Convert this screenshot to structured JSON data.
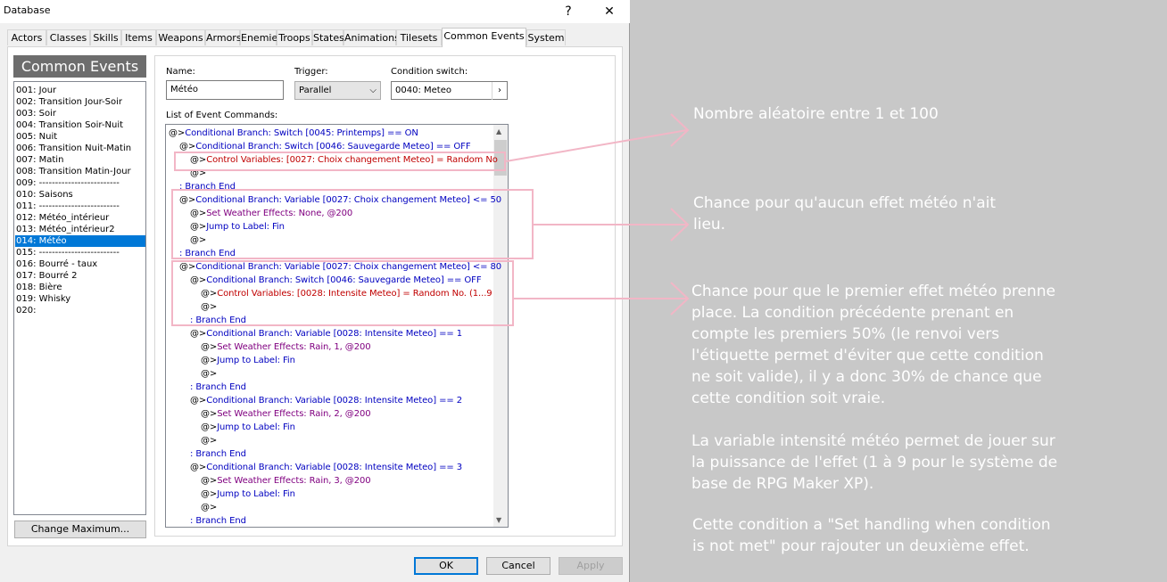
{
  "window": {
    "title": "Database",
    "help_icon": "?",
    "close_icon": "✕"
  },
  "tabs": [
    "Actors",
    "Classes",
    "Skills",
    "Items",
    "Weapons",
    "Armors",
    "Enemies",
    "Troops",
    "States",
    "Animations",
    "Tilesets",
    "Common Events",
    "System"
  ],
  "active_tab": "Common Events",
  "sidebar": {
    "header": "Common Events",
    "items": [
      "001: Jour",
      "002: Transition Jour-Soir",
      "003: Soir",
      "004: Transition Soir-Nuit",
      "005: Nuit",
      "006: Transition Nuit-Matin",
      "007: Matin",
      "008: Transition Matin-Jour",
      "009: -------------------------",
      "010: Saisons",
      "011: -------------------------",
      "012: Météo_intérieur",
      "013: Météo_intérieur2",
      "014: Météo",
      "015: -------------------------",
      "016: Bourré - taux",
      "017: Bourré 2",
      "018: Bière",
      "019: Whisky",
      "020: "
    ],
    "selected_index": 13,
    "change_max_label": "Change Maximum..."
  },
  "form": {
    "name_label": "Name:",
    "name_value": "Météo",
    "trigger_label": "Trigger:",
    "trigger_value": "Parallel",
    "condition_label": "Condition switch:",
    "condition_value": "0040: Meteo",
    "list_label": "List of Event Commands:"
  },
  "commands": [
    {
      "indent": 0,
      "prefix": "@>",
      "text": "Conditional Branch: Switch [0045: Printemps] == ON",
      "color": "#0000c0"
    },
    {
      "indent": 1,
      "prefix": "@>",
      "text": "Conditional Branch: Switch [0046: Sauvegarde Meteo] == OFF",
      "color": "#0000c0"
    },
    {
      "indent": 2,
      "prefix": "@>",
      "text": "Control Variables: [0027: Choix changement Meteo] = Random No",
      "color": "#c00000"
    },
    {
      "indent": 2,
      "prefix": "@>",
      "text": "",
      "color": "#000000"
    },
    {
      "indent": 1,
      "prefix": " : ",
      "text": "Branch End",
      "color": "#0000c0"
    },
    {
      "indent": 1,
      "prefix": "@>",
      "text": "Conditional Branch: Variable [0027: Choix changement Meteo] <= 50",
      "color": "#0000c0"
    },
    {
      "indent": 2,
      "prefix": "@>",
      "text": "Set Weather Effects: None, @200",
      "color": "#800080"
    },
    {
      "indent": 2,
      "prefix": "@>",
      "text": "Jump to Label: Fin",
      "color": "#0000c0"
    },
    {
      "indent": 2,
      "prefix": "@>",
      "text": "",
      "color": "#000000"
    },
    {
      "indent": 1,
      "prefix": " : ",
      "text": "Branch End",
      "color": "#0000c0"
    },
    {
      "indent": 1,
      "prefix": "@>",
      "text": "Conditional Branch: Variable [0027: Choix changement Meteo] <= 80",
      "color": "#0000c0"
    },
    {
      "indent": 2,
      "prefix": "@>",
      "text": "Conditional Branch: Switch [0046: Sauvegarde Meteo] == OFF",
      "color": "#0000c0"
    },
    {
      "indent": 3,
      "prefix": "@>",
      "text": "Control Variables: [0028: Intensite Meteo] = Random No. (1...9",
      "color": "#c00000"
    },
    {
      "indent": 3,
      "prefix": "@>",
      "text": "",
      "color": "#000000"
    },
    {
      "indent": 2,
      "prefix": " : ",
      "text": "Branch End",
      "color": "#0000c0"
    },
    {
      "indent": 2,
      "prefix": "@>",
      "text": "Conditional Branch: Variable [0028: Intensite Meteo] == 1",
      "color": "#0000c0"
    },
    {
      "indent": 3,
      "prefix": "@>",
      "text": "Set Weather Effects: Rain, 1, @200",
      "color": "#800080"
    },
    {
      "indent": 3,
      "prefix": "@>",
      "text": "Jump to Label: Fin",
      "color": "#0000c0"
    },
    {
      "indent": 3,
      "prefix": "@>",
      "text": "",
      "color": "#000000"
    },
    {
      "indent": 2,
      "prefix": " : ",
      "text": "Branch End",
      "color": "#0000c0"
    },
    {
      "indent": 2,
      "prefix": "@>",
      "text": "Conditional Branch: Variable [0028: Intensite Meteo] == 2",
      "color": "#0000c0"
    },
    {
      "indent": 3,
      "prefix": "@>",
      "text": "Set Weather Effects: Rain, 2, @200",
      "color": "#800080"
    },
    {
      "indent": 3,
      "prefix": "@>",
      "text": "Jump to Label: Fin",
      "color": "#0000c0"
    },
    {
      "indent": 3,
      "prefix": "@>",
      "text": "",
      "color": "#000000"
    },
    {
      "indent": 2,
      "prefix": " : ",
      "text": "Branch End",
      "color": "#0000c0"
    },
    {
      "indent": 2,
      "prefix": "@>",
      "text": "Conditional Branch: Variable [0028: Intensite Meteo] == 3",
      "color": "#0000c0"
    },
    {
      "indent": 3,
      "prefix": "@>",
      "text": "Set Weather Effects: Rain, 3, @200",
      "color": "#800080"
    },
    {
      "indent": 3,
      "prefix": "@>",
      "text": "Jump to Label: Fin",
      "color": "#0000c0"
    },
    {
      "indent": 3,
      "prefix": "@>",
      "text": "",
      "color": "#000000"
    },
    {
      "indent": 2,
      "prefix": " : ",
      "text": "Branch End",
      "color": "#0000c0"
    }
  ],
  "buttons": {
    "ok": "OK",
    "cancel": "Cancel",
    "apply": "Apply"
  },
  "annotations": {
    "note1": [
      "Nombre aléatoire entre 1 et 100"
    ],
    "note2": [
      "Chance pour qu'aucun effet météo n'ait",
      "lieu."
    ],
    "note3": [
      "Chance pour que le premier effet météo prenne",
      "place. La condition précédente prenant en",
      "compte les premiers 50% (le renvoi vers",
      "l'étiquette permet d'éviter que cette condition",
      "ne soit valide), il y a donc 30% de chance que",
      "cette condition soit vraie."
    ],
    "note4": [
      "La variable intensité météo permet de jouer sur",
      "la puissance de l'effet (1 à 9 pour le système de",
      "base de RPG Maker XP)."
    ],
    "note5": [
      "Cette condition a \"Set handling when condition",
      "is not met\" pour rajouter un deuxième effet."
    ]
  },
  "colors": {
    "highlight": "#f2b6c6",
    "selection": "#0078d7",
    "background": "#c8c8c8"
  }
}
